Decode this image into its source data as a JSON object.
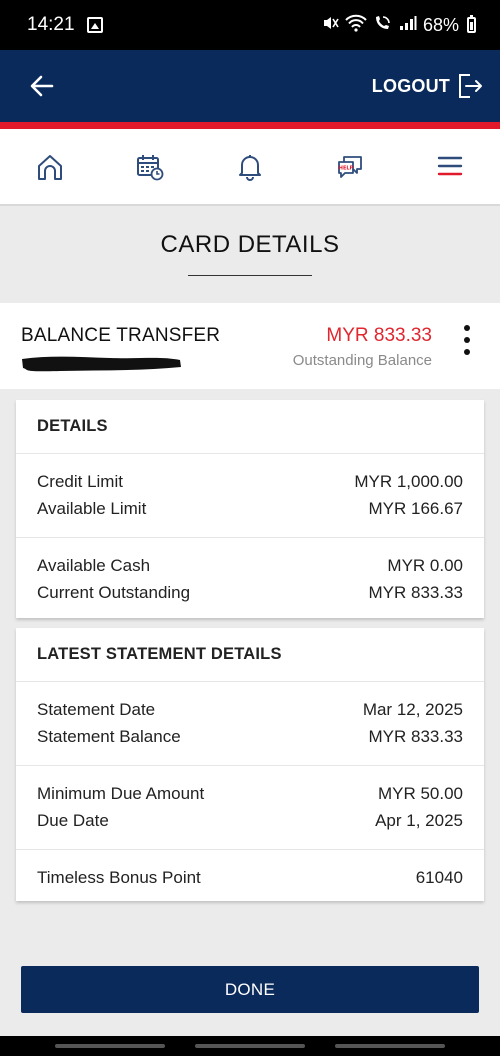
{
  "status_bar": {
    "time": "14:21",
    "battery": "68%",
    "icons": [
      "gallery-icon",
      "mute-icon",
      "wifi-icon",
      "wifi-call-icon",
      "signal-icon",
      "battery-icon"
    ]
  },
  "header": {
    "logout_label": "LOGOUT",
    "colors": {
      "background": "#0b2a5c",
      "accent_line": "#e01a2a"
    }
  },
  "nav": {
    "items": [
      "home-icon",
      "calendar-icon",
      "notifications-icon",
      "help-chat-icon",
      "menu-icon"
    ]
  },
  "page_title": "CARD DETAILS",
  "card": {
    "name": "BALANCE TRANSFER",
    "amount": "MYR 833.33",
    "amount_label": "Outstanding Balance",
    "amount_color": "#e0262e"
  },
  "details_panel": {
    "title": "DETAILS",
    "groups": [
      [
        {
          "label": "Credit Limit",
          "value": "MYR 1,000.00"
        },
        {
          "label": "Available Limit",
          "value": "MYR 166.67"
        }
      ],
      [
        {
          "label": "Available Cash",
          "value": "MYR 0.00"
        },
        {
          "label": "Current Outstanding",
          "value": "MYR 833.33"
        }
      ]
    ]
  },
  "statement_panel": {
    "title": "LATEST STATEMENT DETAILS",
    "groups": [
      [
        {
          "label": "Statement Date",
          "value": "Mar 12, 2025"
        },
        {
          "label": "Statement Balance",
          "value": "MYR 833.33"
        }
      ],
      [
        {
          "label": "Minimum Due Amount",
          "value": "MYR 50.00"
        },
        {
          "label": "Due Date",
          "value": "Apr 1, 2025"
        }
      ],
      [
        {
          "label": "Timeless Bonus Point",
          "value": "61040"
        }
      ]
    ]
  },
  "done_label": "DONE"
}
